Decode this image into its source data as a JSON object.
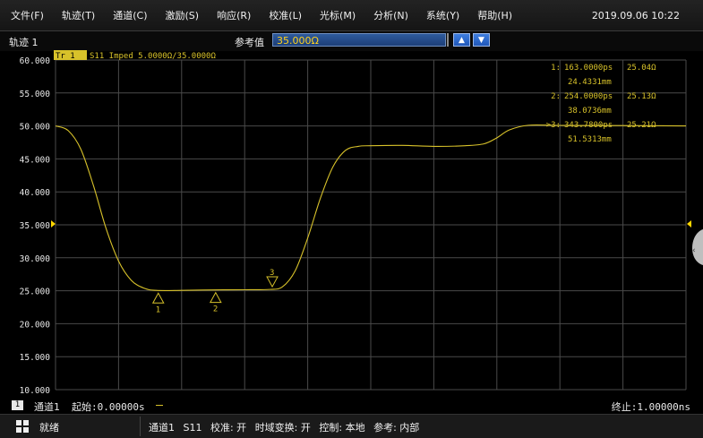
{
  "menu": [
    "文件(F)",
    "轨迹(T)",
    "通道(C)",
    "激励(S)",
    "响应(R)",
    "校准(L)",
    "光标(M)",
    "分析(N)",
    "系统(Y)",
    "帮助(H)"
  ],
  "clock": "2019.09.06 10:22",
  "trace": {
    "title": "轨迹 1",
    "ref_label": "参考值",
    "ref_value": "35.000Ω",
    "tag": "Tr 1",
    "desc": "S11 Imped 5.0000Ω/35.0000Ω"
  },
  "markers": [
    {
      "label": "1:",
      "time": "163.0000ps",
      "value": "25.04Ω",
      "dist": "24.4331mm"
    },
    {
      "label": "2:",
      "time": "254.0000ps",
      "value": "25.13Ω",
      "dist": "38.0736mm"
    },
    {
      "label": ">3:",
      "time": "343.7800ps",
      "value": "25.21Ω",
      "dist": "51.5313mm"
    }
  ],
  "marker_labels": [
    "1",
    "2",
    "3"
  ],
  "footer": {
    "channel_num": "1",
    "channel_name": "通道1",
    "start": "起始:0.00000s",
    "stop": "终止:1.00000ns"
  },
  "status": {
    "ready": "就绪",
    "items": [
      "通道1",
      "S11",
      "校准: 开",
      "时域变换: 开",
      "控制: 本地",
      "参考: 内部"
    ]
  },
  "colors": {
    "trace": "#d8c22a",
    "grid": "#4a4a4a",
    "ref_marker": "#ffd700"
  },
  "chart_data": {
    "type": "line",
    "x_range_ns": [
      0,
      1
    ],
    "ylim": [
      10,
      60
    ],
    "yticks": [
      "60.000",
      "55.000",
      "50.000",
      "45.000",
      "40.000",
      "35.000",
      "30.000",
      "25.000",
      "20.000",
      "15.000",
      "10.000"
    ],
    "x_divisions": 10,
    "reference_level": 35,
    "markers_x_ns": [
      0.163,
      0.254,
      0.34378
    ],
    "markers_y": [
      25.04,
      25.13,
      25.21
    ],
    "series": [
      {
        "x": [
          0,
          0.02,
          0.04,
          0.06,
          0.08,
          0.1,
          0.12,
          0.14,
          0.16,
          0.2,
          0.25,
          0.3,
          0.34,
          0.36,
          0.38,
          0.4,
          0.42,
          0.44,
          0.46,
          0.48,
          0.5,
          0.55,
          0.6,
          0.65,
          0.68,
          0.7,
          0.72,
          0.75,
          0.8,
          0.9,
          1.0
        ],
        "y": [
          50,
          49.3,
          46.5,
          41,
          34.5,
          29.5,
          26.6,
          25.4,
          25.05,
          25.05,
          25.13,
          25.15,
          25.2,
          25.6,
          28,
          33,
          39,
          43.8,
          46.3,
          46.9,
          47,
          47.05,
          46.9,
          47,
          47.3,
          48.2,
          49.4,
          50.1,
          50.08,
          50.05,
          50
        ]
      }
    ]
  }
}
